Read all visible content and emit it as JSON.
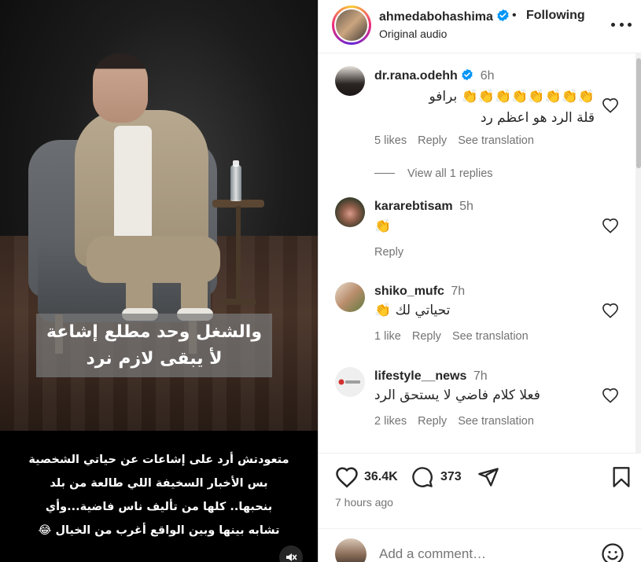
{
  "video": {
    "overlay_caption_lines": [
      "والشغل وحد مطلع إشاعة",
      "لأ يبقى لازم نرد"
    ],
    "post_caption_lines": [
      "متعودتش أرد على إشاعات عن حياتي الشخصية",
      "بس  الأخبار السخيفة اللي طالعة من بلد",
      "بنحبها.. كلها من تأليف ناس فاضية...وأي",
      "تشابه بينها وبين الواقع أغرب من الخيال 😂"
    ],
    "mute_icon": "speaker-muted-icon"
  },
  "header": {
    "username": "ahmedabohashima",
    "separator": "•",
    "following_label": "Following",
    "audio_label": "Original audio",
    "more_icon": "more-horizontal-icon"
  },
  "comments": [
    {
      "username": "dr.rana.odehh",
      "verified": true,
      "time": "6h",
      "text_lines": [
        "👏👏👏👏👏👏👏👏 برافو",
        "قلة الرد هو اعظم رد"
      ],
      "likes": "5 likes",
      "reply": "Reply",
      "translate": "See translation",
      "view_replies": "View all 1 replies"
    },
    {
      "username": "kararebtisam",
      "verified": false,
      "time": "5h",
      "text_lines": [
        "👏"
      ],
      "reply": "Reply"
    },
    {
      "username": "shiko_mufc",
      "verified": false,
      "time": "7h",
      "text_lines": [
        "تحياتي لك 👏"
      ],
      "likes": "1 like",
      "reply": "Reply",
      "translate": "See translation"
    },
    {
      "username": "lifestyle__news",
      "verified": false,
      "time": "7h",
      "text_lines": [
        "فعلا كلام فاضي لا يستحق الرد"
      ],
      "likes": "2 likes",
      "reply": "Reply",
      "translate": "See translation"
    }
  ],
  "actions": {
    "like_count": "36.4K",
    "comment_count": "373",
    "posted": "7 hours ago"
  },
  "add_comment": {
    "placeholder": "Add a comment…"
  },
  "colors": {
    "verified_blue": "#0095f6",
    "text_primary": "#262626",
    "text_secondary": "#737373"
  }
}
